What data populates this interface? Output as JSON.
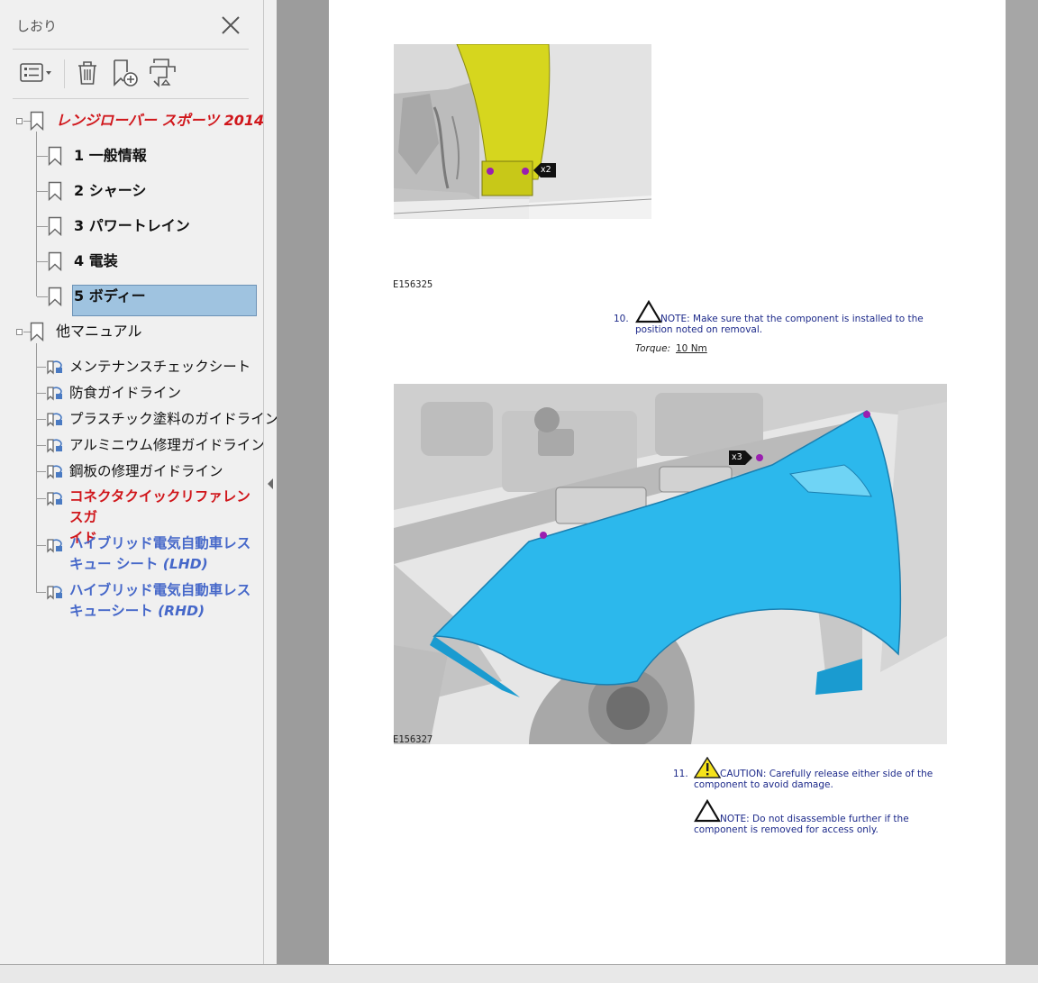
{
  "bookmarks_panel": {
    "title": "しおり",
    "tree": {
      "root": {
        "label": "レンジローバー スポーツ 2014"
      },
      "chapters": [
        {
          "label": "1 一般情報"
        },
        {
          "label": "2 シャーシ"
        },
        {
          "label": "3 パワートレイン"
        },
        {
          "label": "4 電装"
        },
        {
          "label": "5 ボディー",
          "selected": true
        }
      ],
      "other": {
        "label": "他マニュアル",
        "items": [
          {
            "label": "メンテナンスチェックシート"
          },
          {
            "label": "防食ガイドライン"
          },
          {
            "label": "プラスチック塗料のガイドライン"
          },
          {
            "label": "アルミニウム修理ガイドライン"
          },
          {
            "label": "鋼板の修理ガイドライン"
          },
          {
            "label_1": "コネクタクイックリファレンスガ",
            "label_2": "イド"
          },
          {
            "label_1": "ハイブリッド電気自動車レス",
            "label_2a": "キュー シート ",
            "label_2b": "(LHD)"
          },
          {
            "label_1": "ハイブリッド電気自動車レス",
            "label_2a": "キューシート ",
            "label_2b": "(RHD)"
          }
        ]
      }
    }
  },
  "document": {
    "fig1": {
      "code": "E156325",
      "callout": "x2"
    },
    "step10": {
      "number": "10.",
      "note_line1": "NOTE: Make sure that the component is installed to the",
      "note_line2": "position noted on removal.",
      "torque_label": "Torque:",
      "torque_value": "10 Nm"
    },
    "fig2": {
      "code": "E156327",
      "callout": "x3"
    },
    "step11": {
      "number": "11.",
      "caution_line1": "CAUTION: Carefully release either side of the",
      "caution_line2": "component to avoid damage.",
      "note_line1": "NOTE: Do not disassemble further if the",
      "note_line2": "component is removed for access only."
    }
  },
  "colors": {
    "panel_bg": "#f0f0f0",
    "doc_bg": "#9c9c9c",
    "selection": "#9fc3e0",
    "red_link": "#d0161b",
    "blue_link": "#4668c9",
    "note_text": "#1d2a8a",
    "fender_highlight": "#2cb8ec",
    "panel_highlight": "#d6d61e"
  }
}
